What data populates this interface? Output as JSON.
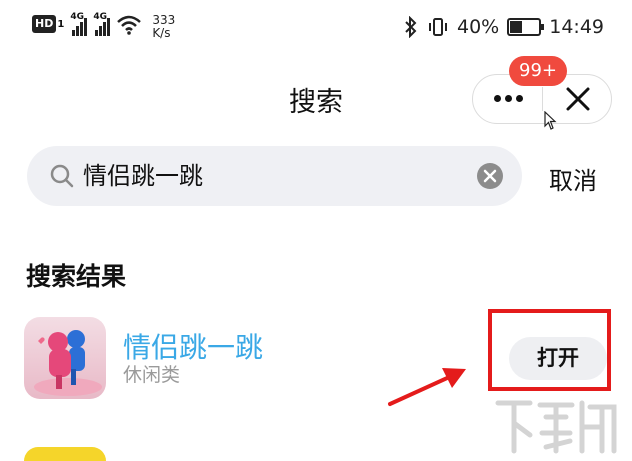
{
  "status_bar": {
    "hd": "HD",
    "hd_sub": "1",
    "net1": "4G",
    "net2": "4G",
    "speed_value": "333",
    "speed_unit": "K/s",
    "battery": "40%",
    "battery_level": 0.4,
    "time": "14:49"
  },
  "header": {
    "title": "搜索",
    "badge": "99+",
    "more_icon": "more-dots-icon",
    "close_icon": "close-icon"
  },
  "search": {
    "query": "情侣跳一跳",
    "cancel_label": "取消",
    "search_icon": "search-icon",
    "clear_icon": "clear-icon"
  },
  "results": {
    "section_title": "搜索结果",
    "items": [
      {
        "name": "情侣跳一跳",
        "category": "休闲类",
        "button_label": "打开",
        "name_color": "#3aa8e6"
      }
    ]
  },
  "colors": {
    "highlight": "#e41b1b",
    "badge": "#f04a3e",
    "search_bg": "#eff0f4"
  }
}
